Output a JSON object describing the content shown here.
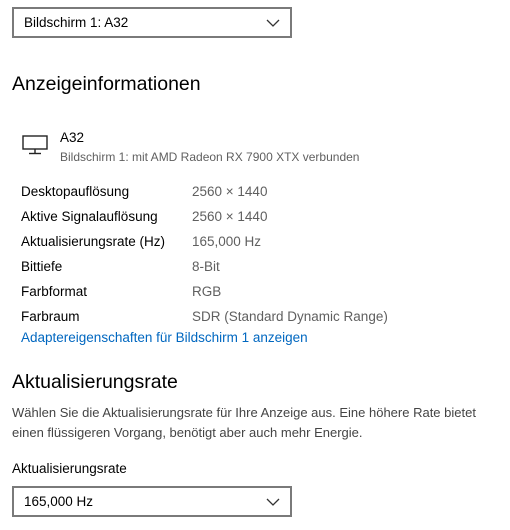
{
  "display_select": {
    "value": "Bildschirm 1: A32",
    "icon": "chevron-down-icon"
  },
  "display_info": {
    "heading": "Anzeigeinformationen",
    "monitor_icon": "monitor-icon",
    "display_name": "A32",
    "display_subtitle": "Bildschirm 1: mit AMD Radeon RX 7900 XTX verbunden",
    "rows": [
      {
        "label": "Desktopauflösung",
        "value": "2560 × 1440"
      },
      {
        "label": "Aktive Signalauflösung",
        "value": "2560 × 1440"
      },
      {
        "label": "Aktualisierungsrate (Hz)",
        "value": "165,000 Hz"
      },
      {
        "label": "Bittiefe",
        "value": "8-Bit"
      },
      {
        "label": "Farbformat",
        "value": "RGB"
      },
      {
        "label": "Farbraum",
        "value": "SDR (Standard Dynamic Range)"
      }
    ],
    "adapter_link": "Adaptereigenschaften für Bildschirm 1 anzeigen"
  },
  "refresh_rate": {
    "heading": "Aktualisierungsrate",
    "description": "Wählen Sie die Aktualisierungsrate für Ihre Anzeige aus. Eine höhere Rate bietet einen flüssigeren Vorgang, benötigt aber auch mehr Energie.",
    "field_label": "Aktualisierungsrate",
    "value": "165,000 Hz",
    "icon": "chevron-down-icon"
  },
  "colors": {
    "link": "#0067c0",
    "secondary_text": "#5f5f5f",
    "border": "#7a7a7a"
  }
}
